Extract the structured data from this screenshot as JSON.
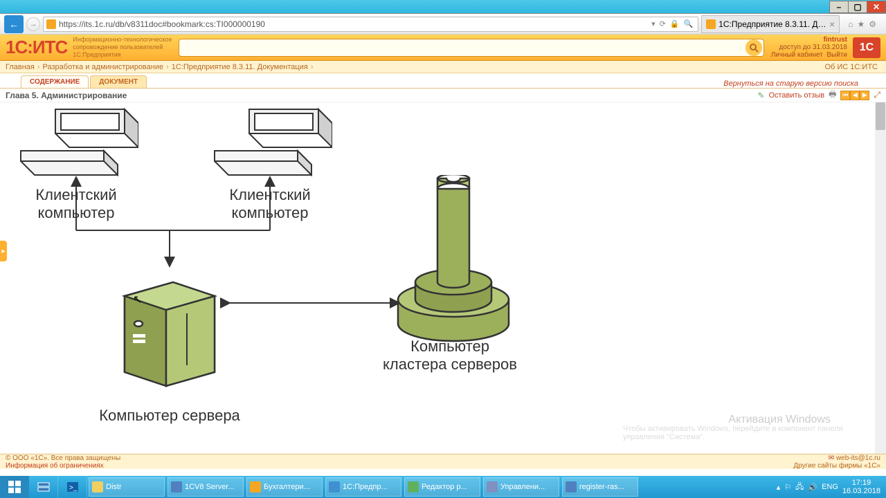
{
  "window": {
    "min": "–",
    "max": "▢",
    "close": "✕"
  },
  "browser": {
    "url": "https://its.1c.ru/db/v8311doc#bookmark:cs:TI000000190",
    "tab_title": "1С:Предприятие 8.3.11. До...",
    "icons": {
      "home": "⌂",
      "star": "★",
      "gear": "⚙"
    }
  },
  "site": {
    "logo": "1С:ИТС",
    "tagline1": "Информационно-технологическое",
    "tagline2": "сопровождение пользователей",
    "tagline3": "1С:Предприятия",
    "user_name": "fintrust",
    "access_until": "доступ до 31.03.2018",
    "cabinet": "Личный кабинет",
    "logout": "Выйти",
    "brand": "1C"
  },
  "breadcrumb": {
    "home": "Главная",
    "sec": "Разработка и администрирование",
    "doc": "1С:Предприятие 8.3.11. Документация",
    "about": "Об ИС 1С:ИТС"
  },
  "tabs": {
    "contents": "СОДЕРЖАНИЕ",
    "document": "ДОКУМЕНТ",
    "old_search": "Вернуться на старую версию поиска"
  },
  "chapter": {
    "title": "Глава 5. Администрирование",
    "feedback": "Оставить отзыв"
  },
  "diagram": {
    "client1": "Клиентский\nкомпьютер",
    "client2": "Клиентский\nкомпьютер",
    "server": "Компьютер сервера",
    "cluster": "Компьютер\nкластера серверов"
  },
  "watermark": {
    "title": "Активация Windows",
    "sub": "Чтобы активировать Windows, перейдите в компонент панели управления \"Система\"."
  },
  "footer": {
    "copyright": "© ООО «1С». Все права защищены",
    "restrictions": "Информация об ограничениях",
    "email": "web-its@1c.ru",
    "other_sites": "Другие сайты фирмы «1С»"
  },
  "taskbar": {
    "apps": [
      {
        "label": "Distr",
        "color": "#f0d060"
      },
      {
        "label": "1CV8 Server...",
        "color": "#5080c0"
      },
      {
        "label": "Бухгалтери...",
        "color": "#f5a623"
      },
      {
        "label": "1С:Предпр...",
        "color": "#4090d0"
      },
      {
        "label": "Редактор р...",
        "color": "#60b060"
      },
      {
        "label": "Управлени...",
        "color": "#8090c0"
      },
      {
        "label": "register-ras...",
        "color": "#5080c0"
      }
    ],
    "lang": "ENG",
    "time": "17:19",
    "date": "16.03.2018"
  }
}
